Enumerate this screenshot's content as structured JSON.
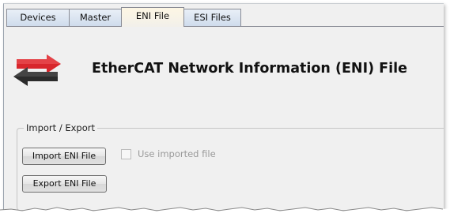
{
  "tabs": [
    {
      "label": "Devices",
      "active": false
    },
    {
      "label": "Master",
      "active": false
    },
    {
      "label": "ENI File",
      "active": true
    },
    {
      "label": "ESI Files",
      "active": false
    }
  ],
  "header": {
    "logo_icon": "ethercat-arrows-icon",
    "title": "EtherCAT Network Information (ENI) File"
  },
  "import_export": {
    "legend": "Import / Export",
    "import_label": "Import ENI File",
    "export_label": "Export ENI File",
    "use_imported": {
      "label": "Use imported file",
      "checked": false,
      "enabled": false
    }
  },
  "colors": {
    "logo_red": "#d8262c",
    "logo_dark": "#2b2b2b",
    "active_tab": "#fdf6e4",
    "panel_bg": "#f0f0f0"
  }
}
